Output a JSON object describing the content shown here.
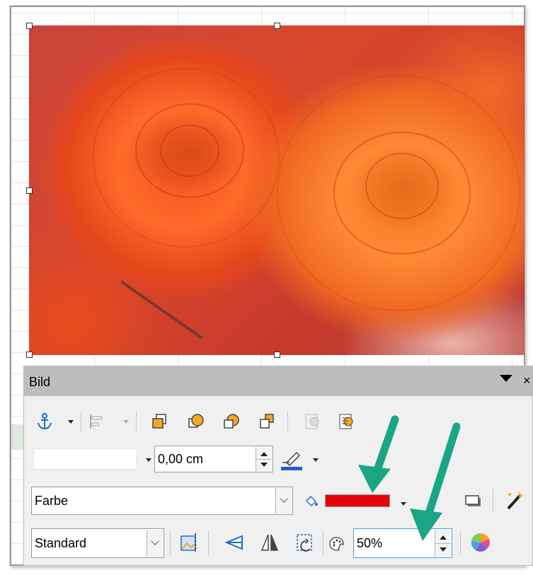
{
  "panel": {
    "title": "Bild",
    "close_glyph": "×"
  },
  "line": {
    "style_value": "",
    "width_value": "0,00 cm"
  },
  "area": {
    "fill_type_value": "Farbe",
    "fill_color": "#e8000a"
  },
  "image": {
    "mode_value": "Standard",
    "transparency_value": "50%"
  },
  "colors": {
    "accent_arrow": "#1aa585",
    "panel_header": "#bdbdbd",
    "anchor_icon": "#1f6fc4",
    "shape_orange": "#f5a623"
  },
  "icons": {
    "anchor": "anchor-icon",
    "align": "align-objects-icon",
    "bring_to_front": "bring-to-front-icon",
    "forward_one": "forward-one-icon",
    "backward_one": "backward-one-icon",
    "send_to_back": "send-to-back-icon",
    "to_background": "to-background-icon",
    "to_foreground": "to-foreground-icon",
    "line_color": "line-color-icon",
    "fill_bucket": "fill-bucket-icon",
    "shadow": "shadow-icon",
    "transformations": "transformations-icon",
    "crop": "crop-icon",
    "flip_vertical": "flip-vertical-icon",
    "flip_horizontal": "flip-horizontal-icon",
    "rotate": "rotate-icon",
    "transparency": "transparency-icon",
    "color_wheel": "color-wheel-icon"
  }
}
